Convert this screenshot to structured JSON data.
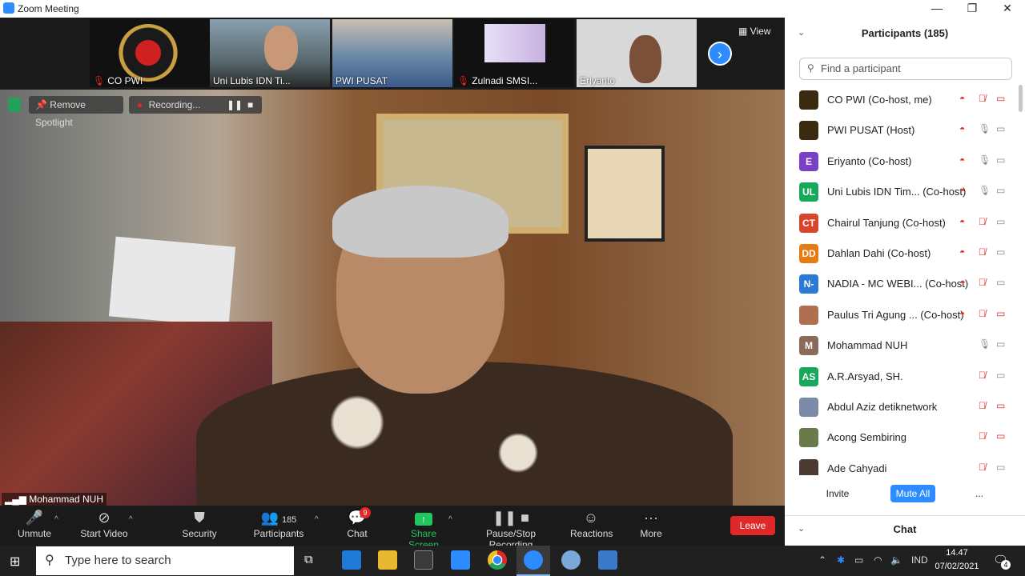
{
  "window": {
    "title": "Zoom Meeting"
  },
  "thumbnails": [
    {
      "name": "CO PWI",
      "muted": true
    },
    {
      "name": "Uni Lubis IDN Ti...",
      "muted": false
    },
    {
      "name": "PWI PUSAT",
      "muted": false
    },
    {
      "name": "Zulnadi SMSI...",
      "muted": true
    },
    {
      "name": "Eriyanto",
      "muted": false
    }
  ],
  "view_label": "View",
  "spotlight": {
    "remove_label": "Remove Spotlight",
    "recording_label": "Recording..."
  },
  "speaker_name": "Mohammad NUH",
  "toolbar": {
    "unmute": "Unmute",
    "start_video": "Start Video",
    "security": "Security",
    "participants": "Participants",
    "participants_count": "185",
    "chat": "Chat",
    "chat_badge": "9",
    "share_screen": "Share Screen",
    "recording": "Pause/Stop Recording",
    "reactions": "Reactions",
    "more": "More",
    "leave": "Leave"
  },
  "panel": {
    "title": "Participants (185)",
    "search_placeholder": "Find a participant",
    "participants": [
      {
        "name": "CO PWI (Co-host, me)",
        "initials": "",
        "color": "#3a2a10",
        "mic_muted": true,
        "video_off": true
      },
      {
        "name": "PWI PUSAT (Host)",
        "initials": "",
        "color": "#3a2a10",
        "mic_muted": false,
        "video_off": false
      },
      {
        "name": "Eriyanto (Co-host)",
        "initials": "E",
        "color": "#7a3fc4",
        "mic_muted": false,
        "video_off": false
      },
      {
        "name": "Uni Lubis IDN Tim... (Co-host)",
        "initials": "UL",
        "color": "#18a85a",
        "mic_muted": false,
        "video_off": false
      },
      {
        "name": "Chairul Tanjung (Co-host)",
        "initials": "CT",
        "color": "#d9442b",
        "mic_muted": true,
        "video_off": false
      },
      {
        "name": "Dahlan Dahi (Co-host)",
        "initials": "DD",
        "color": "#e87a12",
        "mic_muted": true,
        "video_off": false
      },
      {
        "name": "NADIA - MC WEBI... (Co-host)",
        "initials": "N-",
        "color": "#2b7bd6",
        "mic_muted": true,
        "video_off": false
      },
      {
        "name": "Paulus Tri Agung ... (Co-host)",
        "initials": "",
        "color": "#b07050",
        "mic_muted": true,
        "video_off": true
      },
      {
        "name": "Mohammad NUH",
        "initials": "M",
        "color": "#8a6a58",
        "mic_muted": false,
        "video_off": false
      },
      {
        "name": "A.R.Arsyad, SH.",
        "initials": "AS",
        "color": "#18a85a",
        "mic_muted": true,
        "video_off": false
      },
      {
        "name": "Abdul Aziz detiknetwork",
        "initials": "",
        "color": "#7a8aa8",
        "mic_muted": true,
        "video_off": true
      },
      {
        "name": "Acong Sembiring",
        "initials": "",
        "color": "#6a7a4a",
        "mic_muted": true,
        "video_off": true
      },
      {
        "name": "Ade Cahyadi",
        "initials": "",
        "color": "#4a3a30",
        "mic_muted": true,
        "video_off": false
      }
    ],
    "invite": "Invite",
    "mute_all": "Mute All",
    "more": "...",
    "chat_section": "Chat"
  },
  "taskbar": {
    "search_placeholder": "Type here to search",
    "language": "IND",
    "time": "14.47",
    "date": "07/02/2021",
    "notification_count": "4"
  }
}
